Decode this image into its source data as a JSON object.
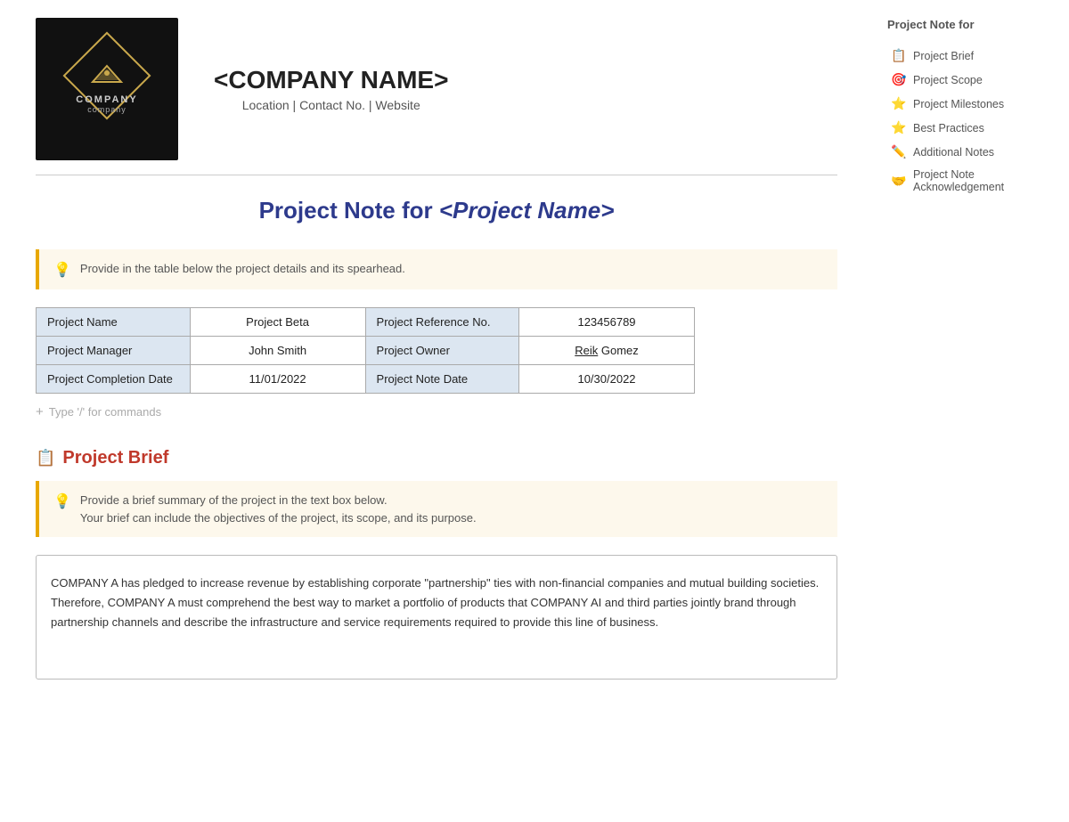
{
  "header": {
    "company_name": "<COMPANY NAME>",
    "company_tagline": "Location | Contact No. | Website",
    "logo_company_label": "COMPANY",
    "logo_sub_label": "company"
  },
  "page_title": {
    "static": "Project Note for ",
    "dynamic": "<Project Name>"
  },
  "callout_intro": {
    "icon": "💡",
    "text": "Provide in the table below the project details and its spearhead."
  },
  "project_table": {
    "rows": [
      {
        "label1": "Project Name",
        "value1": "Project Beta",
        "label2": "Project Reference No.",
        "value2": "123456789"
      },
      {
        "label1": "Project Manager",
        "value1": "John Smith",
        "label2": "Project Owner",
        "value2": "Reik Gomez",
        "value2_underline": true
      },
      {
        "label1": "Project Completion Date",
        "value1": "11/01/2022",
        "label2": "Project Note Date",
        "value2": "10/30/2022"
      }
    ]
  },
  "add_placeholder": "Type '/' for commands",
  "project_brief": {
    "section_icon": "📋",
    "section_title": "Project Brief",
    "callout": {
      "icon": "💡",
      "line1": "Provide a brief summary of the project in the text box below.",
      "line2": "Your brief can include the objectives of the project, its scope, and its purpose."
    },
    "content": "COMPANY A has pledged to increase revenue by establishing corporate \"partnership\" ties with non-financial companies and mutual building societies. Therefore, COMPANY A must comprehend the best way to market a portfolio of products that COMPANY AI and third parties jointly brand through partnership channels and describe the infrastructure and service requirements required to provide this line of business."
  },
  "sidebar": {
    "title": "Project Note for",
    "items": [
      {
        "icon": "📋",
        "label": "Project Brief"
      },
      {
        "icon": "🎯",
        "label": "Project Scope"
      },
      {
        "icon": "⭐",
        "label": "Project Milestones"
      },
      {
        "icon": "⭐",
        "label": "Best Practices"
      },
      {
        "icon": "✏️",
        "label": "Additional Notes"
      },
      {
        "icon": "🤝",
        "label": "Project Note Acknowledgement"
      }
    ]
  }
}
